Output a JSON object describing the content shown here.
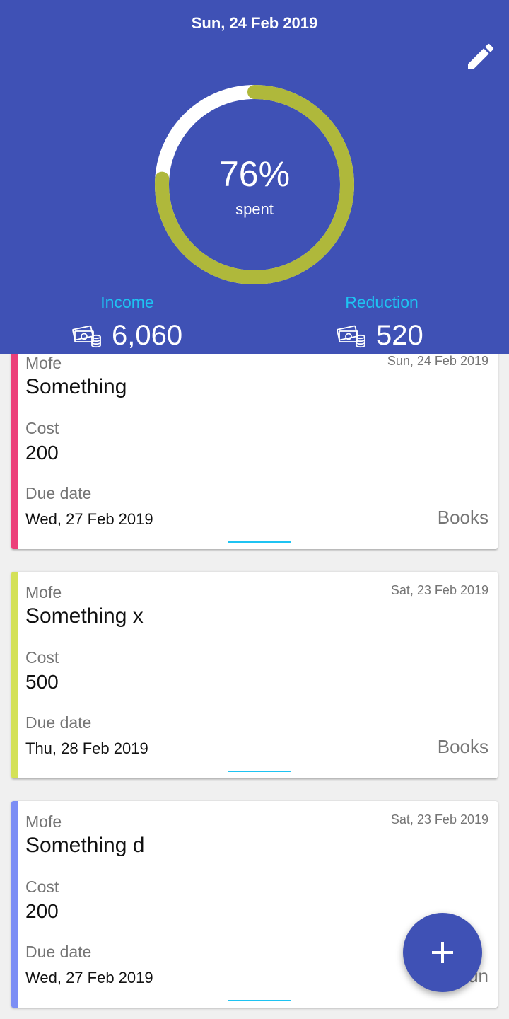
{
  "header": {
    "date": "Sun, 24 Feb 2019",
    "edit_icon": "pencil-icon",
    "spent_percent": 76,
    "spent_percent_text": "76%",
    "spent_label": "spent",
    "income": {
      "label": "Income",
      "value": "6,060",
      "icon": "money-icon"
    },
    "reduction": {
      "label": "Reduction",
      "value": "520",
      "icon": "money-icon"
    }
  },
  "cards": [
    {
      "who": "Mofe",
      "created": "Sun, 24 Feb 2019",
      "name": "Something",
      "cost_label": "Cost",
      "cost": "200",
      "due_label": "Due date",
      "due": "Wed, 27 Feb 2019",
      "category": "Books",
      "color": "#ec407a"
    },
    {
      "who": "Mofe",
      "created": "Sat, 23 Feb 2019",
      "name": "Something x",
      "cost_label": "Cost",
      "cost": "500",
      "due_label": "Due date",
      "due": "Thu, 28 Feb 2019",
      "category": "Books",
      "color": "#d4e157"
    },
    {
      "who": "Mofe",
      "created": "Sat, 23 Feb 2019",
      "name": "Something d",
      "cost_label": "Cost",
      "cost": "200",
      "due_label": "Due date",
      "due": "Wed, 27 Feb 2019",
      "category": "Fun",
      "color": "#7c8ef5"
    }
  ],
  "fab": {
    "icon": "plus-icon"
  },
  "colors": {
    "primary": "#3f51b5",
    "accent": "#1ec3f2",
    "gauge": "#afb83b"
  }
}
